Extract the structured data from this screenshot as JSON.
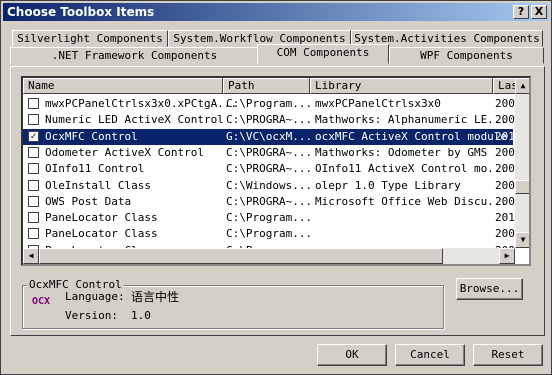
{
  "window": {
    "title": "Choose Toolbox Items",
    "help": "?",
    "close": "X"
  },
  "tabs_back": [
    "Silverlight Components",
    "System.Workflow Components",
    "System.Activities Components"
  ],
  "tabs_front": [
    ".NET Framework Components",
    "COM Components",
    "WPF Components"
  ],
  "columns": [
    "Name",
    "Path",
    "Library",
    "Las"
  ],
  "rows": [
    {
      "checked": false,
      "name": "mwxPCPanelCtrlsx3x0.xPCtgA...",
      "path": "C:\\Program...",
      "library": "mwxPCPanelCtrlsx3x0",
      "last": "200"
    },
    {
      "checked": false,
      "name": "Numeric LED ActiveX Control",
      "path": "C:\\PROGRA~...",
      "library": "Mathworks: Alphanumeric LE...",
      "last": "200"
    },
    {
      "checked": true,
      "name": "OcxMFC Control",
      "path": "G:\\VC\\ocxM...",
      "library": "ocxMFC ActiveX Control module",
      "last": "201",
      "selected": true
    },
    {
      "checked": false,
      "name": "Odometer ActiveX Control",
      "path": "C:\\PROGRA~...",
      "library": "Mathworks: Odometer by GMS",
      "last": "200"
    },
    {
      "checked": false,
      "name": "OInfo11 Control",
      "path": "C:\\PROGRA~...",
      "library": "OInfo11 ActiveX Control mo...",
      "last": "200"
    },
    {
      "checked": false,
      "name": "OleInstall Class",
      "path": "C:\\Windows...",
      "library": "olepr 1.0 Type Library",
      "last": "200"
    },
    {
      "checked": false,
      "name": "OWS Post Data",
      "path": "C:\\PROGRA~...",
      "library": "Microsoft Office Web Discu...",
      "last": "200"
    },
    {
      "checked": false,
      "name": "PaneLocator Class",
      "path": "C:\\Program...",
      "library": "",
      "last": "201"
    },
    {
      "checked": false,
      "name": "PaneLocator Class",
      "path": "C:\\Program...",
      "library": "",
      "last": "200"
    },
    {
      "checked": false,
      "name": "PaneLocator Class",
      "path": "C:\\Program...",
      "library": "",
      "last": "200"
    }
  ],
  "details": {
    "group_title": "OcxMFC Control",
    "icon_text": "OCX",
    "language_label": "Language:",
    "language_value": "语言中性",
    "version_label": "Version:",
    "version_value": "1.0"
  },
  "buttons": {
    "browse": "Browse...",
    "ok": "OK",
    "cancel": "Cancel",
    "reset": "Reset"
  },
  "colors": {
    "selection": "#0a246a",
    "face": "#d4d0c8",
    "title_gradient_start": "#0a246a",
    "title_gradient_end": "#a6caf0"
  }
}
